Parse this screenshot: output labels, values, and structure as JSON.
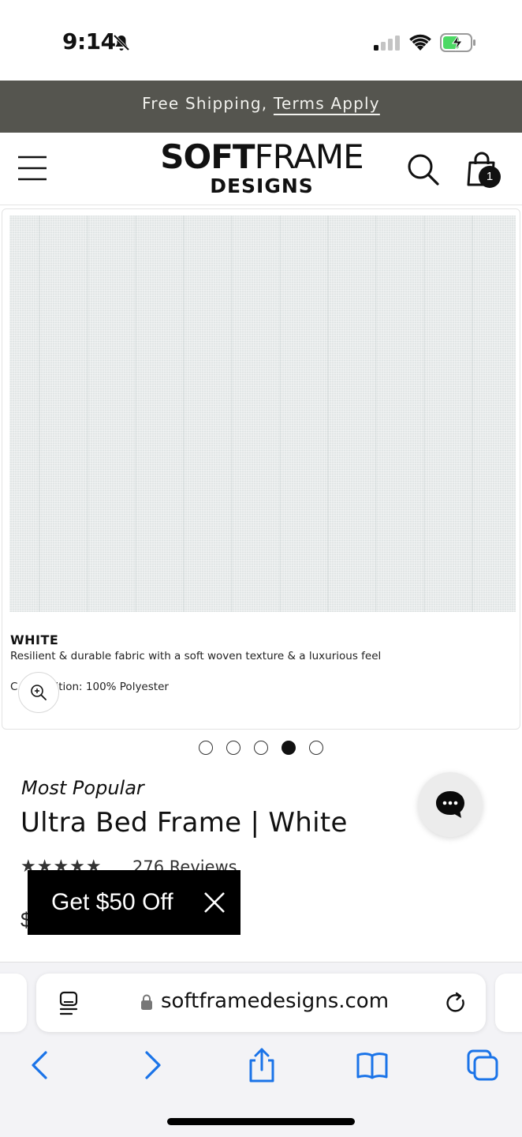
{
  "status_bar": {
    "time": "9:14"
  },
  "announcement": {
    "text": "Free Shipping, ",
    "link": "Terms Apply"
  },
  "header": {
    "logo_line1_bold": "SOFT",
    "logo_line1_light": "FRAME",
    "logo_line2": "DESIGNS",
    "cart_count": "1"
  },
  "swatch": {
    "name": "WHITE",
    "description": "Resilient & durable fabric with a soft woven texture & a luxurious feel",
    "composition_prefix": "C",
    "composition_rest": "ition: 100% Polyester"
  },
  "carousel": {
    "count": 5,
    "active_index": 3
  },
  "product": {
    "tag": "Most Popular",
    "title": "Ultra Bed Frame | White",
    "stars": "★★★★★",
    "reviews": "276 Reviews",
    "price_peek": "$"
  },
  "promo": {
    "label": "Get $50 Off"
  },
  "browser": {
    "url": "softframedesigns.com"
  },
  "colors": {
    "announcement_bg": "#55554f",
    "ios_blue": "#1a73e8",
    "promo_bg": "#000000"
  }
}
